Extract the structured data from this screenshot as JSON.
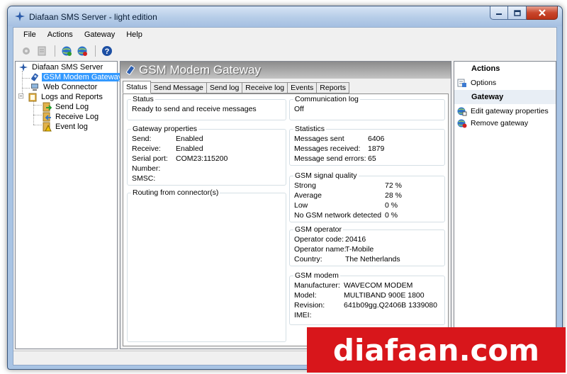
{
  "window": {
    "title": "Diafaan SMS Server - light edition"
  },
  "menu": [
    "File",
    "Actions",
    "Gateway",
    "Help"
  ],
  "toolbar": {
    "icons": [
      "gear-disabled-icon",
      "document-disabled-icon",
      "globe-add-icon",
      "globe-remove-icon",
      "help-icon"
    ]
  },
  "tree": {
    "root": "Diafaan SMS Server",
    "gsm": "GSM Modem Gateway",
    "web": "Web Connector",
    "logs": "Logs and Reports",
    "send_log": "Send Log",
    "receive_log": "Receive Log",
    "event_log": "Event log"
  },
  "header": {
    "title": "GSM Modem Gateway"
  },
  "tabs": [
    "Status",
    "Send Message",
    "Send log",
    "Receive log",
    "Events",
    "Reports"
  ],
  "status": {
    "title": "Status",
    "text": "Ready to send and receive messages"
  },
  "comm_log": {
    "title": "Communication log",
    "text": "Off"
  },
  "gateway_props": {
    "title": "Gateway properties",
    "rows": [
      {
        "k": "Send:",
        "v": "Enabled"
      },
      {
        "k": "Receive:",
        "v": "Enabled"
      },
      {
        "k": "Serial port:",
        "v": "COM23:115200"
      },
      {
        "k": "Number:",
        "v": ""
      },
      {
        "k": "SMSC:",
        "v": ""
      }
    ]
  },
  "routing": {
    "title": "Routing from connector(s)"
  },
  "statistics": {
    "title": "Statistics",
    "rows": [
      {
        "k": "Messages sent",
        "v": "6406"
      },
      {
        "k": "Messages received:",
        "v": "1879"
      },
      {
        "k": "Message send errors:",
        "v": "65"
      }
    ]
  },
  "signal": {
    "title": "GSM signal quality",
    "rows": [
      {
        "k": "Strong",
        "v": "72 %"
      },
      {
        "k": "Average",
        "v": "28 %"
      },
      {
        "k": "Low",
        "v": "0 %"
      },
      {
        "k": "No GSM network detected",
        "v": "0 %"
      }
    ]
  },
  "operator": {
    "title": "GSM operator",
    "rows": [
      {
        "k": "Operator code:",
        "v": "20416"
      },
      {
        "k": "Operator name:",
        "v": "T-Mobile"
      },
      {
        "k": "Country:",
        "v": "The Netherlands"
      }
    ]
  },
  "modem": {
    "title": "GSM modem",
    "rows": [
      {
        "k": "Manufacturer:",
        "v": "WAVECOM MODEM"
      },
      {
        "k": "Model:",
        "v": "MULTIBAND  900E  1800"
      },
      {
        "k": "Revision:",
        "v": "641b09gg.Q2406B 1339080"
      },
      {
        "k": "IMEI:",
        "v": ""
      }
    ]
  },
  "actions": {
    "title": "Actions",
    "options": "Options",
    "gateway_title": "Gateway",
    "edit": "Edit gateway properties",
    "remove": "Remove gateway"
  },
  "watermark": "diafaan.com",
  "colors": {
    "selection": "#3399ff",
    "watermark_bg": "#d8161b",
    "header_band": "#a0a0a0"
  }
}
